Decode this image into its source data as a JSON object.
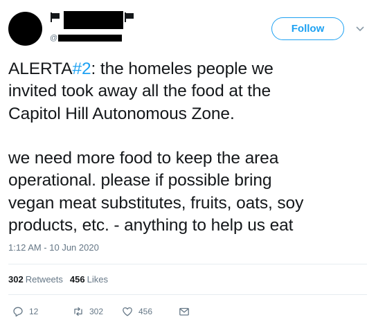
{
  "header": {
    "handle_prefix": "@",
    "follow_label": "Follow"
  },
  "tweet": {
    "text_prefix": "ALERTA",
    "hashtag": "#2",
    "text_rest": ": the homeles people we\ninvited took away all the food at the\nCapitol Hill Autonomous Zone.\n\nwe need more food to keep the area\noperational. please if possible bring\nvegan meat substitutes, fruits, oats, soy\nproducts, etc. - anything to help us eat",
    "timestamp": "1:12 AM - 10 Jun 2020"
  },
  "stats": {
    "retweets_count": "302",
    "retweets_label": "Retweets",
    "likes_count": "456",
    "likes_label": "Likes"
  },
  "actions": {
    "reply_count": "12",
    "retweet_count": "302",
    "like_count": "456"
  },
  "colors": {
    "accent": "#1da1f2",
    "text": "#14171a",
    "secondary": "#657786"
  },
  "icons": [
    "flag-icon",
    "chevron-down-icon",
    "reply-icon",
    "retweet-icon",
    "like-icon",
    "mail-icon"
  ]
}
